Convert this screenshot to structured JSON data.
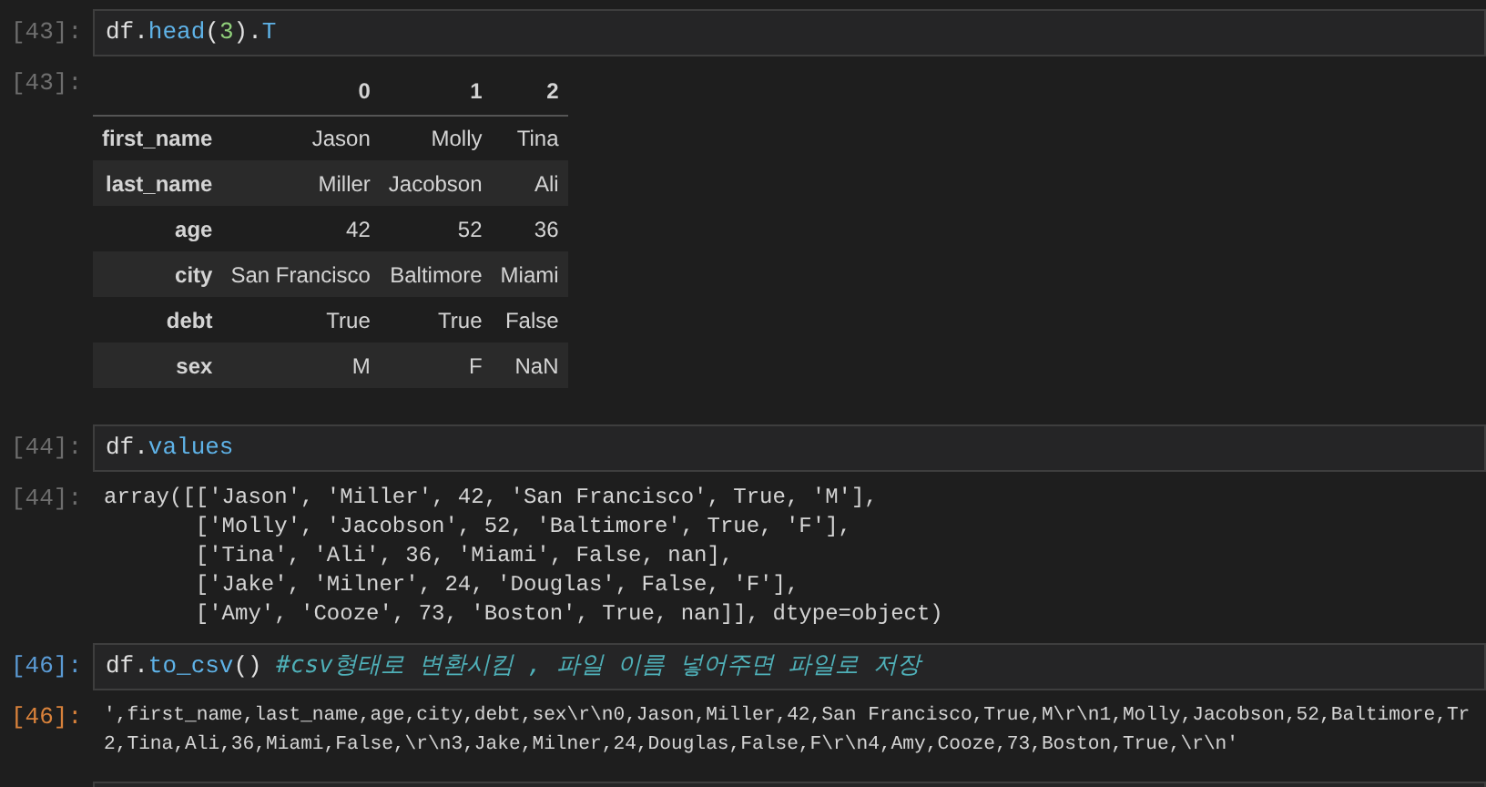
{
  "cells": [
    {
      "active": false,
      "input_prompt": "[43]:",
      "code": [
        {
          "kind": "name",
          "text": "df"
        },
        {
          "kind": "op",
          "text": "."
        },
        {
          "kind": "attr",
          "text": "head"
        },
        {
          "kind": "op",
          "text": "("
        },
        {
          "kind": "number",
          "text": "3"
        },
        {
          "kind": "op",
          "text": ")."
        },
        {
          "kind": "attr",
          "text": "T"
        }
      ],
      "output_prompt": "[43]:",
      "output": {
        "kind": "table",
        "columns": [
          "0",
          "1",
          "2"
        ],
        "rows": [
          {
            "index": "first_name",
            "values": [
              "Jason",
              "Molly",
              "Tina"
            ]
          },
          {
            "index": "last_name",
            "values": [
              "Miller",
              "Jacobson",
              "Ali"
            ]
          },
          {
            "index": "age",
            "values": [
              "42",
              "52",
              "36"
            ]
          },
          {
            "index": "city",
            "values": [
              "San Francisco",
              "Baltimore",
              "Miami"
            ]
          },
          {
            "index": "debt",
            "values": [
              "True",
              "True",
              "False"
            ]
          },
          {
            "index": "sex",
            "values": [
              "M",
              "F",
              "NaN"
            ]
          }
        ]
      }
    },
    {
      "active": false,
      "input_prompt": "[44]:",
      "code": [
        {
          "kind": "name",
          "text": "df"
        },
        {
          "kind": "op",
          "text": "."
        },
        {
          "kind": "attr",
          "text": "values"
        }
      ],
      "output_prompt": "[44]:",
      "output": {
        "kind": "text",
        "lines": [
          "array([['Jason', 'Miller', 42, 'San Francisco', True, 'M'],",
          "       ['Molly', 'Jacobson', 52, 'Baltimore', True, 'F'],",
          "       ['Tina', 'Ali', 36, 'Miami', False, nan],",
          "       ['Jake', 'Milner', 24, 'Douglas', False, 'F'],",
          "       ['Amy', 'Cooze', 73, 'Boston', True, nan]], dtype=object)"
        ]
      }
    },
    {
      "active": true,
      "input_prompt": "[46]:",
      "code": [
        {
          "kind": "name",
          "text": "df"
        },
        {
          "kind": "op",
          "text": "."
        },
        {
          "kind": "attr",
          "text": "to_csv"
        },
        {
          "kind": "op",
          "text": "() "
        },
        {
          "kind": "comment",
          "text": "#csv형태로 변환시킴 , 파일 이름 넣어주면 파일로 저장"
        }
      ],
      "output_prompt": "[46]:",
      "output": {
        "kind": "text",
        "lines": [
          "',first_name,last_name,age,city,debt,sex\\r\\n0,Jason,Miller,42,San Francisco,True,M\\r\\n1,Molly,Jacobson,52,Baltimore,Tr",
          "2,Tina,Ali,36,Miami,False,\\r\\n3,Jake,Milner,24,Douglas,False,F\\r\\n4,Amy,Cooze,73,Boston,True,\\r\\n'"
        ]
      }
    }
  ]
}
